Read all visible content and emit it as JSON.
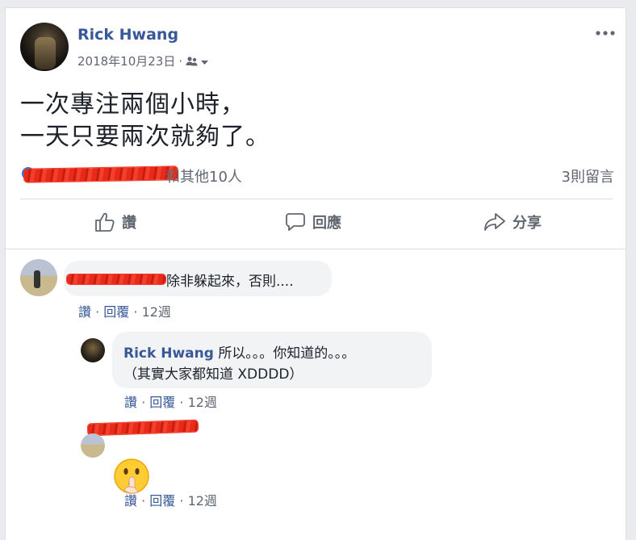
{
  "post": {
    "author": "Rick Hwang",
    "date": "2018年10月23日",
    "date_sep": "·",
    "text_line1": "一次專注兩個小時，",
    "text_line2": "一天只要兩次就夠了。",
    "reactions_text": "和其他10人",
    "comment_count": "3則留言"
  },
  "actions": {
    "like": "讚",
    "comment": "回應",
    "share": "分享"
  },
  "comments": [
    {
      "text": "除非躲起來，否則....",
      "like": "讚",
      "reply": "回覆",
      "time": "12週"
    },
    {
      "author": "Rick Hwang",
      "text_line1": "所以。。。你知道的。。。",
      "text_line2": "（其實大家都知道 XDDDD）",
      "like": "讚",
      "reply": "回覆",
      "time": "12週"
    },
    {
      "emoji": "shushing-face",
      "like": "讚",
      "reply": "回覆",
      "time": "12週"
    }
  ],
  "colors": {
    "link": "#385898",
    "meta": "#606770",
    "bubble": "#f2f3f5",
    "redaction": "#e02414"
  }
}
